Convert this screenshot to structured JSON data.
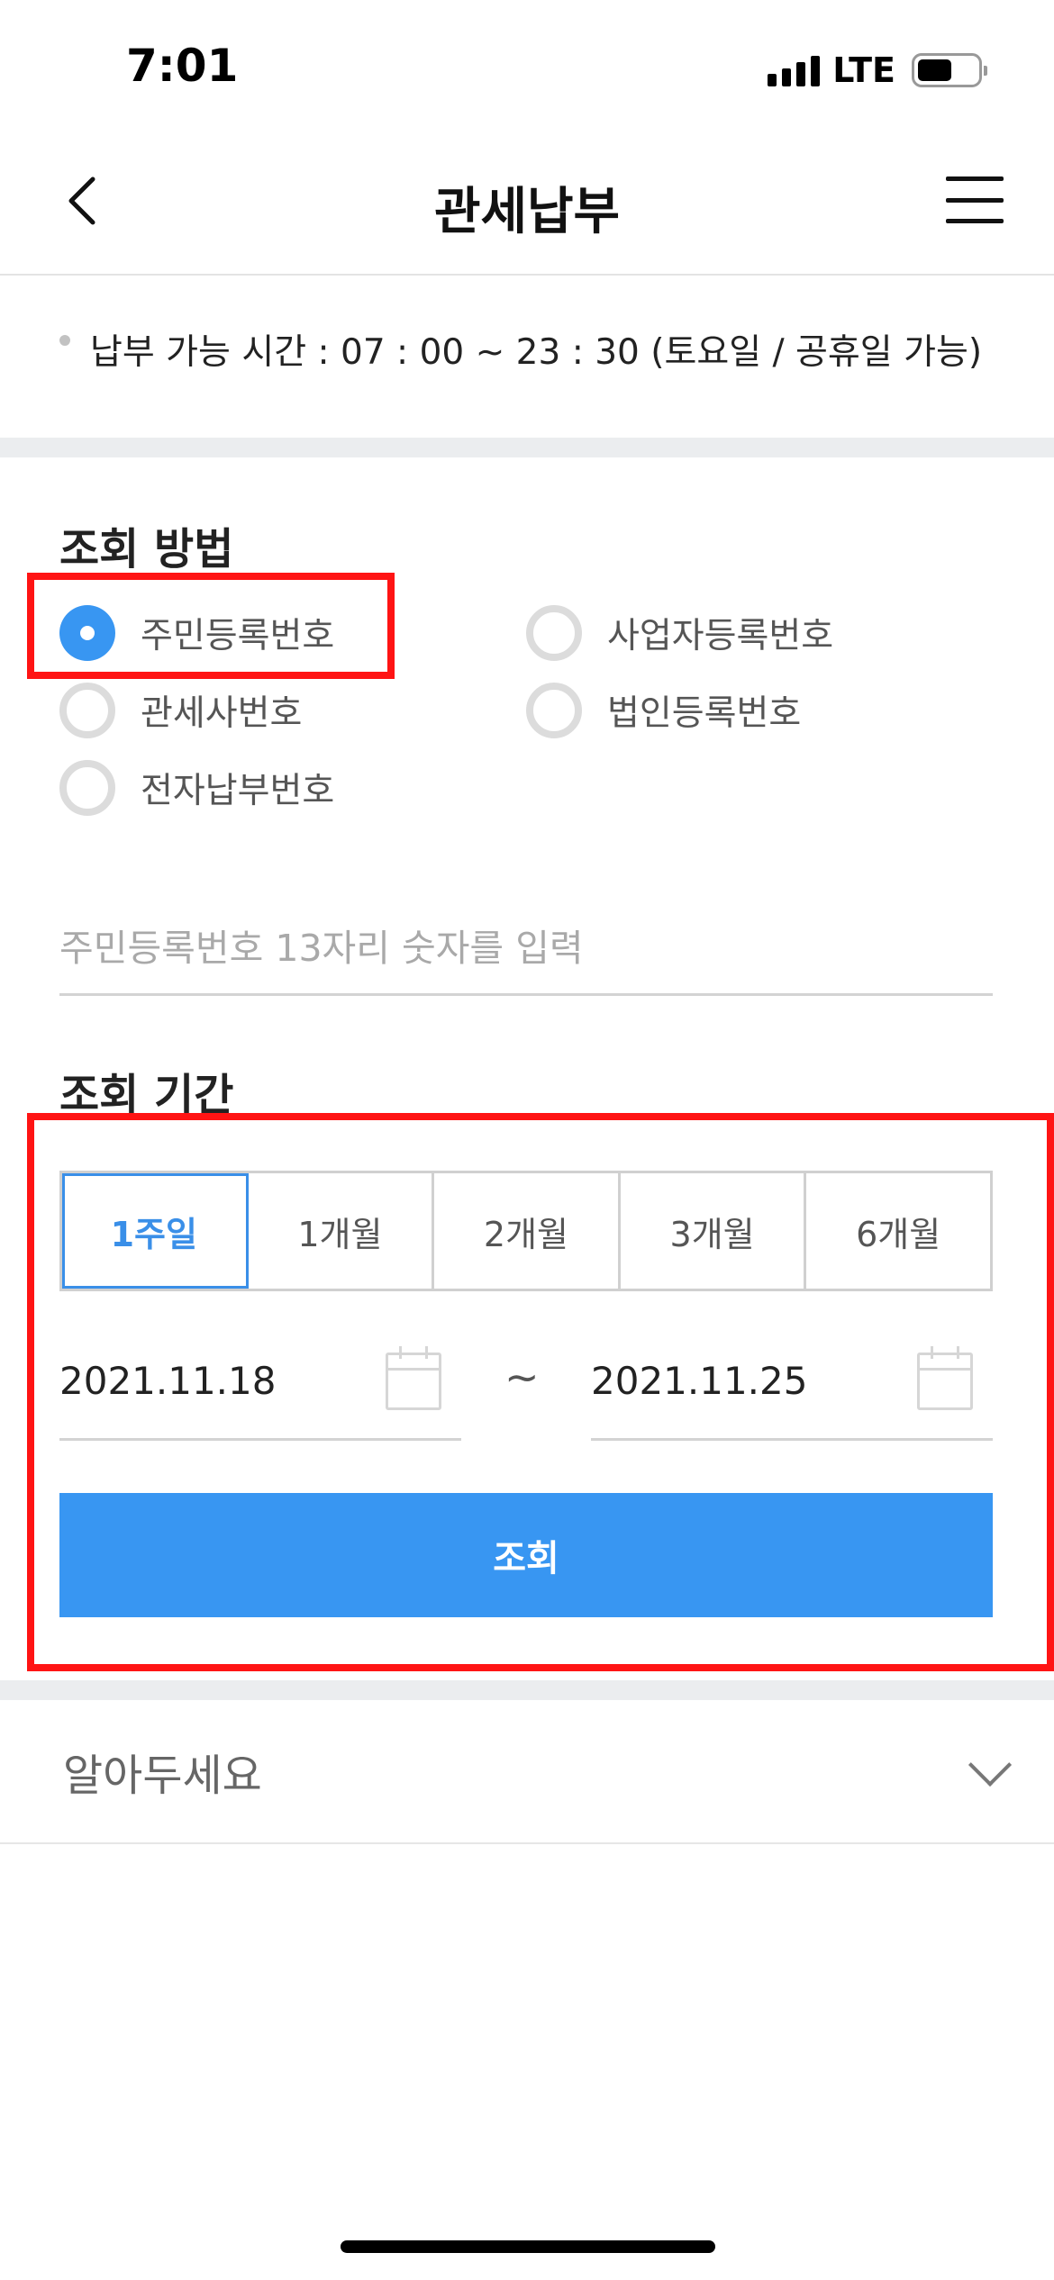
{
  "status_bar": {
    "time": "7:01",
    "network": "LTE"
  },
  "header": {
    "title": "관세납부"
  },
  "notice": {
    "text": "납부 가능 시간 : 07 : 00 ~ 23 : 30 (토요일 / 공휴일 가능)"
  },
  "lookup_method": {
    "title": "조회 방법",
    "selected": "주민등록번호",
    "options": [
      "주민등록번호",
      "사업자등록번호",
      "관세사번호",
      "법인등록번호",
      "전자납부번호"
    ]
  },
  "id_input": {
    "placeholder": "주민등록번호 13자리 숫자를 입력"
  },
  "lookup_period": {
    "title": "조회 기간",
    "tabs": [
      "1주일",
      "1개월",
      "2개월",
      "3개월",
      "6개월"
    ],
    "active_tab": "1주일",
    "start_date": "2021.11.18",
    "separator": "~",
    "end_date": "2021.11.25"
  },
  "search_button": {
    "label": "조회"
  },
  "accordion": {
    "label": "알아두세요"
  },
  "colors": {
    "accent": "#3896f2",
    "highlight": "#ff1414",
    "active_tab_text": "#3a8fe8"
  },
  "icons": [
    "back-icon",
    "menu-icon",
    "calendar-icon",
    "chevron-down-icon",
    "signal-icon",
    "battery-icon"
  ]
}
